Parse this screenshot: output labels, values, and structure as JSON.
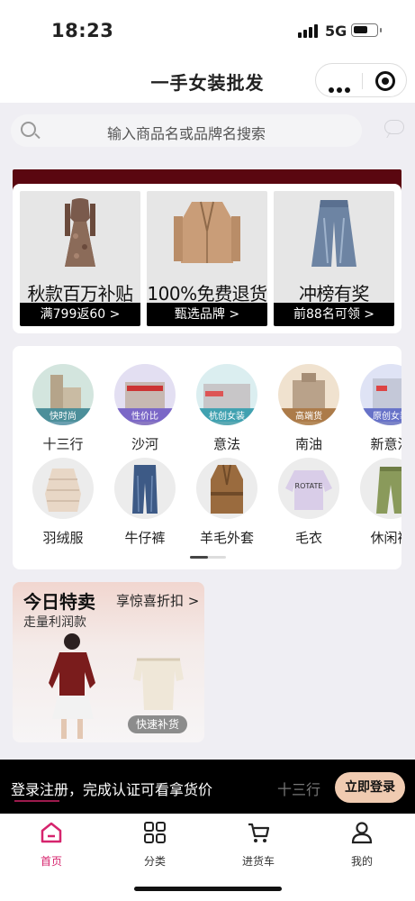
{
  "status": {
    "time": "18:23",
    "network": "5G"
  },
  "nav": {
    "title": "一手女装批发"
  },
  "search": {
    "placeholder": "输入商品名或品牌名搜索"
  },
  "promo_cards": [
    {
      "headline": "秋款百万补贴",
      "cta": "满799返60 >"
    },
    {
      "headline": "100%免费退货",
      "cta": "甄选品牌 >"
    },
    {
      "headline": "冲榜有奖",
      "cta": "前88名可领 >"
    }
  ],
  "categories_row1": [
    {
      "label": "十三行",
      "tag": "快时尚"
    },
    {
      "label": "沙河",
      "tag": "性价比"
    },
    {
      "label": "意法",
      "tag": "杭创女装"
    },
    {
      "label": "南油",
      "tag": "高端货"
    },
    {
      "label": "新意法",
      "tag": "原创女装"
    }
  ],
  "categories_row2": [
    {
      "label": "羽绒服"
    },
    {
      "label": "牛仔裤"
    },
    {
      "label": "羊毛外套"
    },
    {
      "label": "毛衣"
    },
    {
      "label": "休闲裤"
    }
  ],
  "flash_sale": {
    "title": "今日特卖",
    "link": "享惊喜折扣 >",
    "subtitle": "走量利润款",
    "badge": "快速补货",
    "sweater_text": "ROTATE"
  },
  "login_banner": {
    "message": "登录注册，完成认证可看拿货价",
    "ghost_text": "十三行",
    "button": "立即登录"
  },
  "tabs": [
    {
      "label": "首页",
      "active": true
    },
    {
      "label": "分类",
      "active": false
    },
    {
      "label": "进货车",
      "active": false
    },
    {
      "label": "我的",
      "active": false
    }
  ],
  "colors": {
    "accent": "#d6246d",
    "promo_band": "#5a0710",
    "login_button": "#f0cbb1"
  }
}
